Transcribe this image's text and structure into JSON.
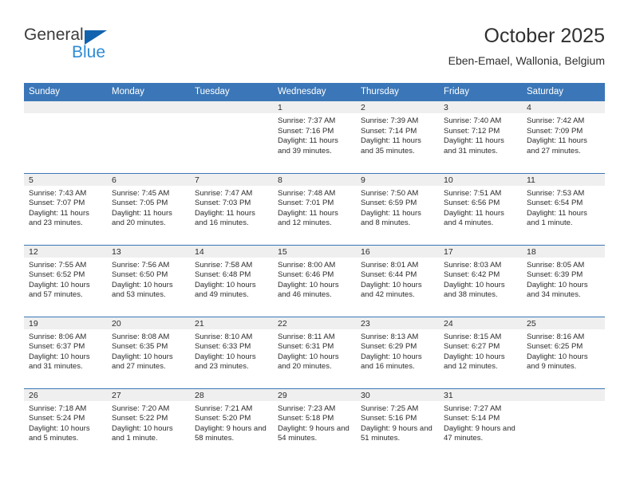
{
  "brand": {
    "name_part1": "General",
    "name_part2": "Blue",
    "triangle_color": "#1263ad",
    "blue_text_color": "#2e8bd4"
  },
  "header": {
    "month_title": "October 2025",
    "location": "Eben-Emael, Wallonia, Belgium"
  },
  "theme": {
    "header_blue": "#3b77b8",
    "daynum_band": "#efefef",
    "text": "#2b2b2b"
  },
  "weekdays": [
    "Sunday",
    "Monday",
    "Tuesday",
    "Wednesday",
    "Thursday",
    "Friday",
    "Saturday"
  ],
  "weeks": [
    [
      {
        "day": "",
        "sunrise": "",
        "sunset": "",
        "daylight": ""
      },
      {
        "day": "",
        "sunrise": "",
        "sunset": "",
        "daylight": ""
      },
      {
        "day": "",
        "sunrise": "",
        "sunset": "",
        "daylight": ""
      },
      {
        "day": "1",
        "sunrise": "Sunrise: 7:37 AM",
        "sunset": "Sunset: 7:16 PM",
        "daylight": "Daylight: 11 hours and 39 minutes."
      },
      {
        "day": "2",
        "sunrise": "Sunrise: 7:39 AM",
        "sunset": "Sunset: 7:14 PM",
        "daylight": "Daylight: 11 hours and 35 minutes."
      },
      {
        "day": "3",
        "sunrise": "Sunrise: 7:40 AM",
        "sunset": "Sunset: 7:12 PM",
        "daylight": "Daylight: 11 hours and 31 minutes."
      },
      {
        "day": "4",
        "sunrise": "Sunrise: 7:42 AM",
        "sunset": "Sunset: 7:09 PM",
        "daylight": "Daylight: 11 hours and 27 minutes."
      }
    ],
    [
      {
        "day": "5",
        "sunrise": "Sunrise: 7:43 AM",
        "sunset": "Sunset: 7:07 PM",
        "daylight": "Daylight: 11 hours and 23 minutes."
      },
      {
        "day": "6",
        "sunrise": "Sunrise: 7:45 AM",
        "sunset": "Sunset: 7:05 PM",
        "daylight": "Daylight: 11 hours and 20 minutes."
      },
      {
        "day": "7",
        "sunrise": "Sunrise: 7:47 AM",
        "sunset": "Sunset: 7:03 PM",
        "daylight": "Daylight: 11 hours and 16 minutes."
      },
      {
        "day": "8",
        "sunrise": "Sunrise: 7:48 AM",
        "sunset": "Sunset: 7:01 PM",
        "daylight": "Daylight: 11 hours and 12 minutes."
      },
      {
        "day": "9",
        "sunrise": "Sunrise: 7:50 AM",
        "sunset": "Sunset: 6:59 PM",
        "daylight": "Daylight: 11 hours and 8 minutes."
      },
      {
        "day": "10",
        "sunrise": "Sunrise: 7:51 AM",
        "sunset": "Sunset: 6:56 PM",
        "daylight": "Daylight: 11 hours and 4 minutes."
      },
      {
        "day": "11",
        "sunrise": "Sunrise: 7:53 AM",
        "sunset": "Sunset: 6:54 PM",
        "daylight": "Daylight: 11 hours and 1 minute."
      }
    ],
    [
      {
        "day": "12",
        "sunrise": "Sunrise: 7:55 AM",
        "sunset": "Sunset: 6:52 PM",
        "daylight": "Daylight: 10 hours and 57 minutes."
      },
      {
        "day": "13",
        "sunrise": "Sunrise: 7:56 AM",
        "sunset": "Sunset: 6:50 PM",
        "daylight": "Daylight: 10 hours and 53 minutes."
      },
      {
        "day": "14",
        "sunrise": "Sunrise: 7:58 AM",
        "sunset": "Sunset: 6:48 PM",
        "daylight": "Daylight: 10 hours and 49 minutes."
      },
      {
        "day": "15",
        "sunrise": "Sunrise: 8:00 AM",
        "sunset": "Sunset: 6:46 PM",
        "daylight": "Daylight: 10 hours and 46 minutes."
      },
      {
        "day": "16",
        "sunrise": "Sunrise: 8:01 AM",
        "sunset": "Sunset: 6:44 PM",
        "daylight": "Daylight: 10 hours and 42 minutes."
      },
      {
        "day": "17",
        "sunrise": "Sunrise: 8:03 AM",
        "sunset": "Sunset: 6:42 PM",
        "daylight": "Daylight: 10 hours and 38 minutes."
      },
      {
        "day": "18",
        "sunrise": "Sunrise: 8:05 AM",
        "sunset": "Sunset: 6:39 PM",
        "daylight": "Daylight: 10 hours and 34 minutes."
      }
    ],
    [
      {
        "day": "19",
        "sunrise": "Sunrise: 8:06 AM",
        "sunset": "Sunset: 6:37 PM",
        "daylight": "Daylight: 10 hours and 31 minutes."
      },
      {
        "day": "20",
        "sunrise": "Sunrise: 8:08 AM",
        "sunset": "Sunset: 6:35 PM",
        "daylight": "Daylight: 10 hours and 27 minutes."
      },
      {
        "day": "21",
        "sunrise": "Sunrise: 8:10 AM",
        "sunset": "Sunset: 6:33 PM",
        "daylight": "Daylight: 10 hours and 23 minutes."
      },
      {
        "day": "22",
        "sunrise": "Sunrise: 8:11 AM",
        "sunset": "Sunset: 6:31 PM",
        "daylight": "Daylight: 10 hours and 20 minutes."
      },
      {
        "day": "23",
        "sunrise": "Sunrise: 8:13 AM",
        "sunset": "Sunset: 6:29 PM",
        "daylight": "Daylight: 10 hours and 16 minutes."
      },
      {
        "day": "24",
        "sunrise": "Sunrise: 8:15 AM",
        "sunset": "Sunset: 6:27 PM",
        "daylight": "Daylight: 10 hours and 12 minutes."
      },
      {
        "day": "25",
        "sunrise": "Sunrise: 8:16 AM",
        "sunset": "Sunset: 6:25 PM",
        "daylight": "Daylight: 10 hours and 9 minutes."
      }
    ],
    [
      {
        "day": "26",
        "sunrise": "Sunrise: 7:18 AM",
        "sunset": "Sunset: 5:24 PM",
        "daylight": "Daylight: 10 hours and 5 minutes."
      },
      {
        "day": "27",
        "sunrise": "Sunrise: 7:20 AM",
        "sunset": "Sunset: 5:22 PM",
        "daylight": "Daylight: 10 hours and 1 minute."
      },
      {
        "day": "28",
        "sunrise": "Sunrise: 7:21 AM",
        "sunset": "Sunset: 5:20 PM",
        "daylight": "Daylight: 9 hours and 58 minutes."
      },
      {
        "day": "29",
        "sunrise": "Sunrise: 7:23 AM",
        "sunset": "Sunset: 5:18 PM",
        "daylight": "Daylight: 9 hours and 54 minutes."
      },
      {
        "day": "30",
        "sunrise": "Sunrise: 7:25 AM",
        "sunset": "Sunset: 5:16 PM",
        "daylight": "Daylight: 9 hours and 51 minutes."
      },
      {
        "day": "31",
        "sunrise": "Sunrise: 7:27 AM",
        "sunset": "Sunset: 5:14 PM",
        "daylight": "Daylight: 9 hours and 47 minutes."
      },
      {
        "day": "",
        "sunrise": "",
        "sunset": "",
        "daylight": ""
      }
    ]
  ]
}
